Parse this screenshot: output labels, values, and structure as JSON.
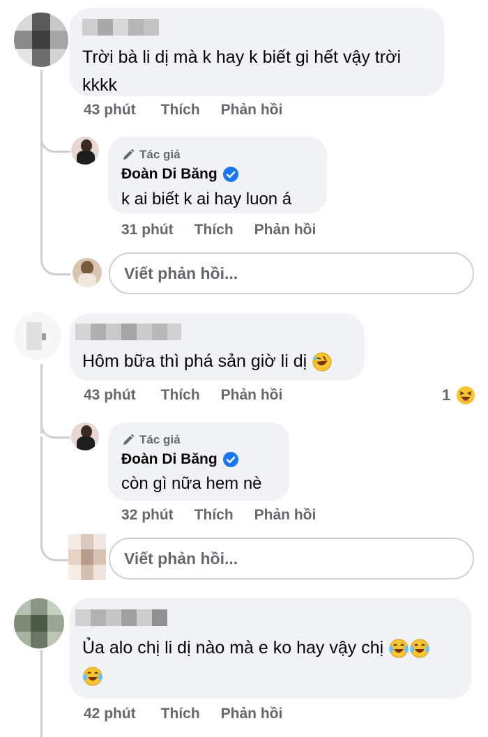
{
  "comments": [
    {
      "text_line1": "Trời bà li dị mà k hay k biết gi hết vậy trời",
      "text_line2": "kkkk",
      "time": "43 phút",
      "like": "Thích",
      "reply": "Phản hồi"
    },
    {
      "text_line1": "Hôm bữa thì phá sản giờ li dị",
      "time": "43 phút",
      "like": "Thích",
      "reply": "Phản hồi",
      "reaction_count": "1"
    },
    {
      "text_line1": "Ủa alo chị li dị nào mà e ko hay vậy chị",
      "time": "42 phút",
      "like": "Thích",
      "reply": "Phản hồi"
    }
  ],
  "replies": [
    {
      "author_tag": "Tác giả",
      "author_name": "Đoàn Di Băng",
      "text": "k ai biết k ai hay luon á",
      "time": "31 phút",
      "like": "Thích",
      "reply": "Phản hồi"
    },
    {
      "author_tag": "Tác giả",
      "author_name": "Đoàn Di Băng",
      "text": "còn gì nữa hem nè",
      "time": "32 phút",
      "like": "Thích",
      "reply": "Phản hồi"
    }
  ],
  "reply_input": {
    "placeholder": "Viết phản hồi..."
  },
  "colors": {
    "bubble": "#f0f2f5",
    "meta_text": "#65676b",
    "verified": "#1877f2",
    "thread_line": "#ccd0d5"
  },
  "icons": [
    "pencil-icon",
    "verified-badge-icon",
    "rolling-laughing-emoji",
    "squinting-laugh-emoji",
    "tears-of-joy-emoji"
  ]
}
